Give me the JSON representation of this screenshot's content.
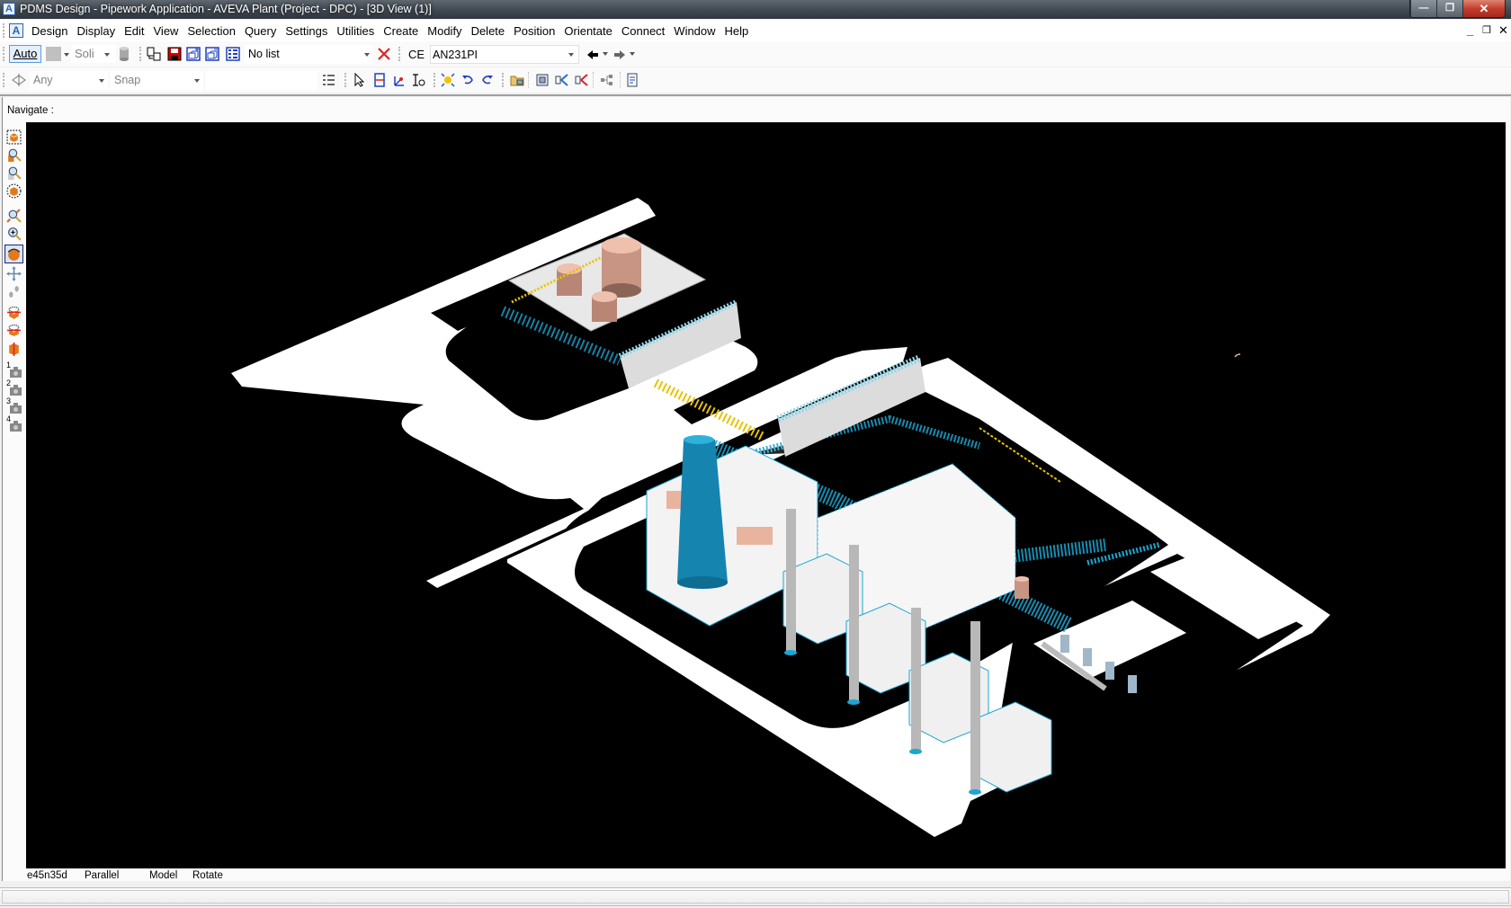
{
  "window": {
    "title": "PDMS Design - Pipework Application -  AVEVA Plant (Project - DPC) - [3D View (1)]",
    "app_icon_glyph": "A",
    "controls": {
      "minimize": "—",
      "restore": "❐",
      "close": "✕"
    }
  },
  "menubar": {
    "items": [
      "Design",
      "Display",
      "Edit",
      "View",
      "Selection",
      "Query",
      "Settings",
      "Utilities",
      "Create",
      "Modify",
      "Delete",
      "Position",
      "Orientate",
      "Connect",
      "Window",
      "Help"
    ],
    "mdi_controls": {
      "minimize": "_",
      "restore": "🗗",
      "close": "✕"
    }
  },
  "toolbar1": {
    "auto_label": "Auto",
    "render_style": "Soli",
    "list_selected": "No list",
    "ce_label": "CE",
    "ce_value": "AN231PI",
    "icons": [
      "copy-icon",
      "save-icon",
      "add-to-list-icon",
      "remove-from-list-icon",
      "list-icon",
      "clear-list-icon",
      "back-arrow-icon",
      "forward-arrow-icon"
    ],
    "colors": {
      "save": "#d40000",
      "clear": "#e02020",
      "icon_blue": "#1f3fbf"
    }
  },
  "toolbar2": {
    "pick_filter": "Any",
    "snap": "Snap",
    "icons": [
      "grid-icon",
      "select-pointer-icon",
      "select-box-icon",
      "axes-icon",
      "text-cursor-icon",
      "light-icon",
      "undo-icon",
      "redo-icon",
      "folder-view-icon",
      "limits-icon",
      "expand-icon",
      "collapse-icon",
      "hierarchy-icon",
      "report-icon"
    ]
  },
  "navigate": {
    "label": "Navigate :",
    "tools": [
      "view-limits-icon",
      "zoom-ce-icon",
      "zoom-selection-icon",
      "view-all-icon",
      "zoom-window-icon",
      "zoom-in-icon",
      "rotate-icon",
      "pan-icon",
      "walk-icon",
      "clip-plane-icon",
      "clip-ce-icon",
      "section-icon",
      "saved-view-1-icon",
      "saved-view-2-icon",
      "saved-view-3-icon",
      "saved-view-4-icon"
    ],
    "saved_view_numbers": [
      "1",
      "2",
      "3",
      "4"
    ]
  },
  "viewport": {
    "background": "#000000",
    "colors": {
      "ground": "#ffffff",
      "pipe_cyan": "#1aa6d0",
      "pipe_yellow": "#e8c200",
      "equipment": "#e8b4a0",
      "stack": "#1585b0",
      "chimney": "#b8b8b8"
    }
  },
  "status": {
    "direction": "e45n35d",
    "projection": "Parallel",
    "mode": "Model",
    "action": "Rotate"
  }
}
